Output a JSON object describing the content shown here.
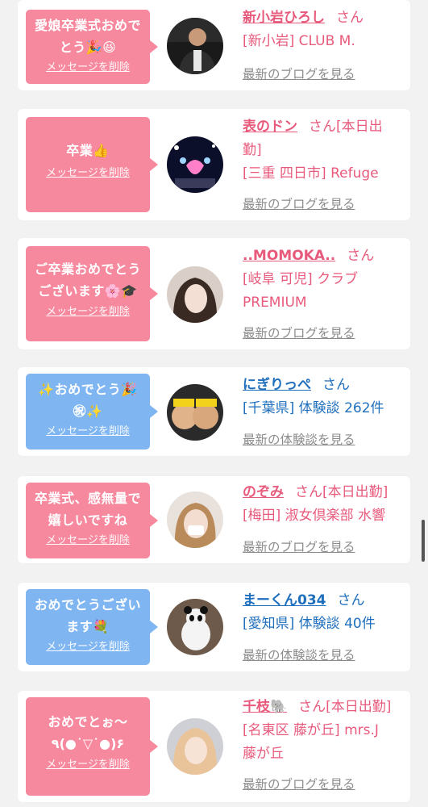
{
  "common": {
    "delete_label": "メッセージを削除",
    "san": "さん"
  },
  "cards": [
    {
      "message_l1": "愛娘卒業式おめで",
      "message_l2": "とう🎉😆",
      "name": "新小岩ひろし",
      "san_suffix": "さん",
      "detail_l1": "[新小岩] CLUB M.",
      "detail_l2": "",
      "link": "最新のブログを見る",
      "theme": "pink"
    },
    {
      "message_l1": "卒業👍",
      "message_l2": "",
      "name": "表のドン",
      "san_suffix": "さん[本日出",
      "name_l2": "勤]",
      "detail_l1": "[三重 四日市] Refuge",
      "detail_l2": "",
      "link": "最新のブログを見る",
      "theme": "pink"
    },
    {
      "message_l1": "ご卒業おめでとう",
      "message_l2": "ございます🌸🎓",
      "name": "..MOMOKA..",
      "san_suffix": "さん",
      "detail_l1": "[岐阜 可児] クラブ",
      "detail_l2": "PREMIUM",
      "link": "最新のブログを見る",
      "theme": "pink"
    },
    {
      "message_l1": "✨おめでとう🎉",
      "message_l2": "㊗✨",
      "name": "にぎりっぺ",
      "san_suffix": "さん",
      "detail_l1": "[千葉県] 体験談 262件",
      "detail_l2": "",
      "link": "最新の体験談を見る",
      "theme": "blue"
    },
    {
      "message_l1": "卒業式、感無量で",
      "message_l2": "嬉しいですね",
      "name": "のぞみ",
      "san_suffix": "さん[本日出勤]",
      "detail_l1": "[梅田] 淑女倶楽部 水響",
      "detail_l2": "",
      "link": "最新のブログを見る",
      "theme": "pink"
    },
    {
      "message_l1": "おめでとうござい",
      "message_l2": "ます💐",
      "name": "まーくん034",
      "san_suffix": "さん",
      "detail_l1": "[愛知県] 体験談 40件",
      "detail_l2": "",
      "link": "最新の体験談を見る",
      "theme": "blue"
    },
    {
      "message_l1": "おめでとぉ～",
      "message_l2": "٩(●˙▽˙●)۶",
      "name": "千枝🐘",
      "san_suffix": "さん[本日出勤]",
      "detail_l1": "[名東区 藤が丘] mrs.J",
      "detail_l2": "藤が丘",
      "link": "最新のブログを見る",
      "theme": "pink"
    }
  ]
}
